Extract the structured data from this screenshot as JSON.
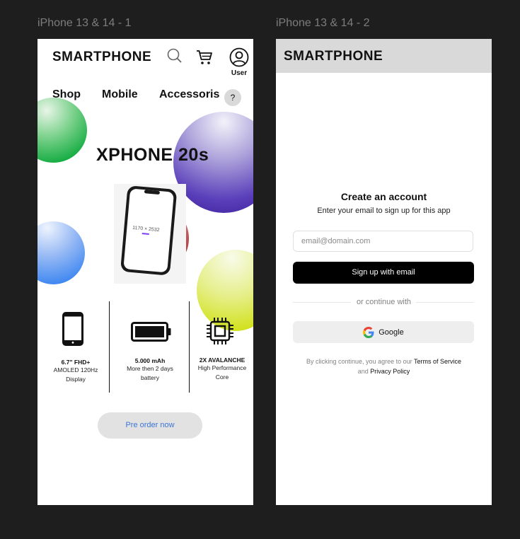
{
  "frames": [
    {
      "label": "iPhone 13 & 14 - 1"
    },
    {
      "label": "iPhone 13 & 14 - 2"
    }
  ],
  "screen1": {
    "brand": "SMARTPHONE",
    "header_icons": [
      "search-icon",
      "cart-icon",
      "user-icon"
    ],
    "user_label": "User",
    "nav": [
      "Shop",
      "Mobile",
      "Accessoris"
    ],
    "help_label": "?",
    "hero_title": "XPHONE 20s",
    "phone_screen_text": "1170 × 2532",
    "features": [
      {
        "icon": "smartphone-icon",
        "title": "6.7\" FHD+",
        "lines": [
          "AMOLED 120Hz",
          "Display"
        ]
      },
      {
        "icon": "battery-icon",
        "title": "5.000 mAh",
        "lines": [
          "More then 2 days",
          "battery"
        ]
      },
      {
        "icon": "chip-icon",
        "title": "2X AVALANCHE",
        "lines": [
          "High Performance",
          "Core"
        ]
      }
    ],
    "preorder_label": "Pre order now",
    "colors": {
      "blob_green": "#1db34a",
      "blob_purple": "#4a2fa8",
      "blob_blue": "#3d86f0",
      "blob_yellow": "#d6e61a",
      "blob_red": "#a9252d",
      "cta_text": "#3b74d8"
    }
  },
  "screen2": {
    "brand": "SMARTPHONE",
    "title": "Create an account",
    "subtitle": "Enter your email to sign up for this app",
    "email_placeholder": "email@domain.com",
    "signup_label": "Sign up with email",
    "divider_text": "or continue with",
    "google_label": "Google",
    "terms_prefix": "By clicking continue, you agree to our",
    "terms_link": "Terms of Service",
    "terms_and": "and",
    "privacy_link": "Privacy Policy"
  }
}
